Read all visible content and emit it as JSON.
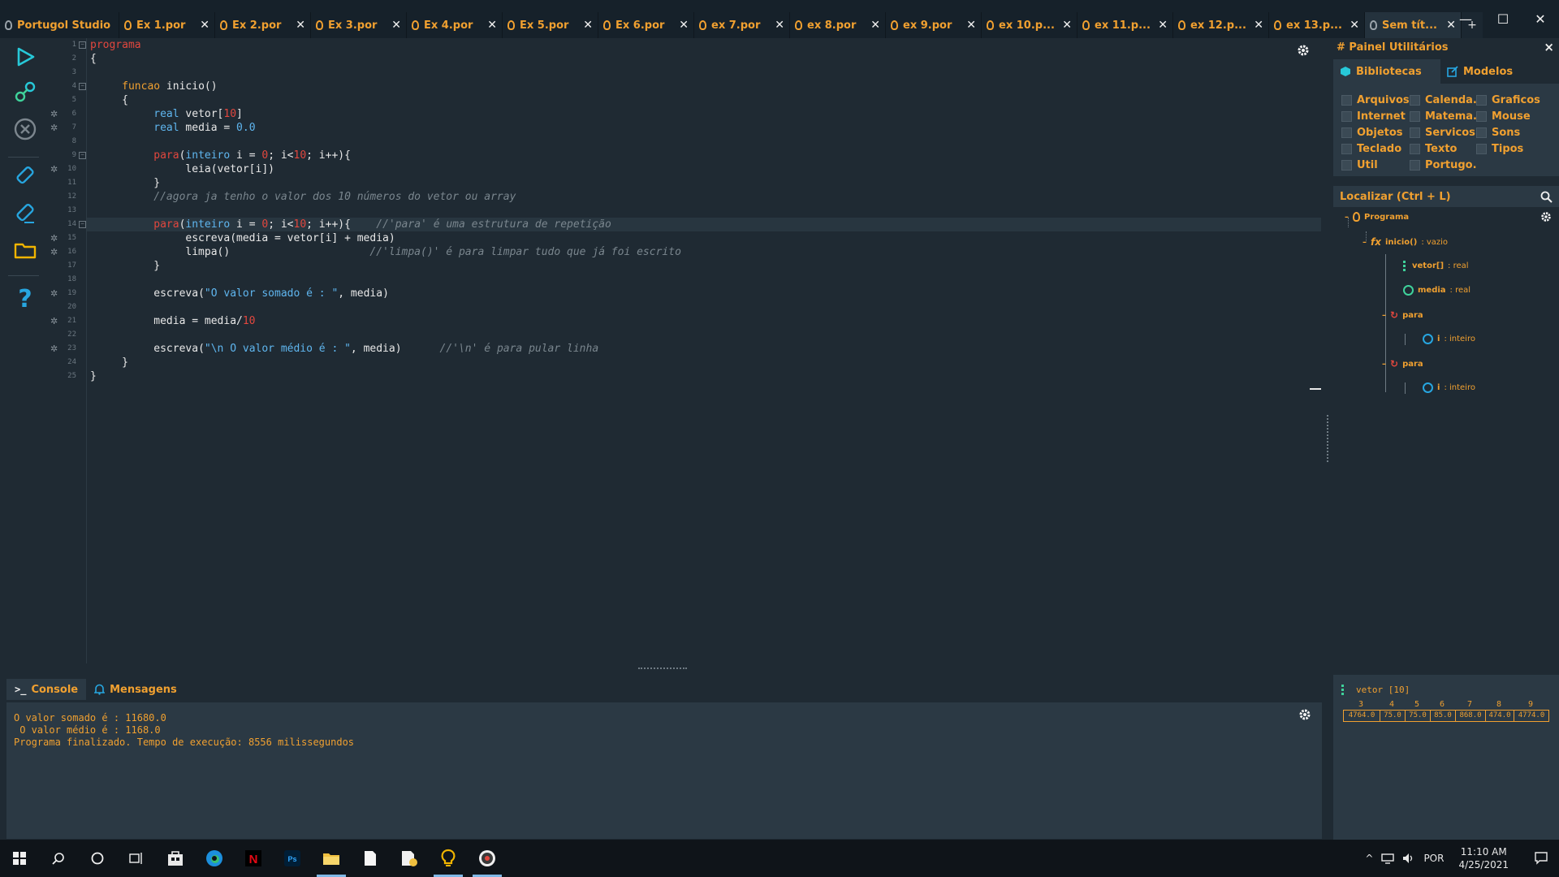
{
  "tabs": [
    {
      "label": "Portugol Studio",
      "closable": false
    },
    {
      "label": "Ex 1.por",
      "closable": true
    },
    {
      "label": "Ex 2.por",
      "closable": true
    },
    {
      "label": "Ex 3.por",
      "closable": true
    },
    {
      "label": "Ex 4.por",
      "closable": true
    },
    {
      "label": "Ex 5.por",
      "closable": true
    },
    {
      "label": "Ex 6.por",
      "closable": true
    },
    {
      "label": "ex 7.por",
      "closable": true
    },
    {
      "label": "ex 8.por",
      "closable": true
    },
    {
      "label": "ex 9.por",
      "closable": true
    },
    {
      "label": "ex 10.p...",
      "closable": true
    },
    {
      "label": "ex 11.p...",
      "closable": true
    },
    {
      "label": "ex 12.p...",
      "closable": true
    },
    {
      "label": "ex 13.p...",
      "closable": true
    },
    {
      "label": "Sem tít...",
      "closable": true,
      "active": true
    }
  ],
  "new_tab": "+",
  "window_controls": {
    "minimize": "—",
    "maximize": "☐",
    "close": "✕"
  },
  "toolbar": {
    "run": "run-icon",
    "debug": "debug-icon",
    "stop": "stop-icon",
    "save": "save-icon",
    "save_as": "save-as-icon",
    "open": "folder-icon",
    "help": "?"
  },
  "code_lines": [
    {
      "n": "1",
      "fold": true,
      "bug": false,
      "html": "<span class='kw'>programa</span>"
    },
    {
      "n": "2",
      "fold": false,
      "bug": false,
      "html": "<span class='plain'>{</span>"
    },
    {
      "n": "3",
      "fold": false,
      "bug": false,
      "html": ""
    },
    {
      "n": "4",
      "fold": true,
      "bug": false,
      "html": "     <span class='fn-kw'>funcao</span><span class='plain'> inicio()</span>"
    },
    {
      "n": "5",
      "fold": false,
      "bug": false,
      "html": "     <span class='plain'>{</span>"
    },
    {
      "n": "6",
      "fold": false,
      "bug": true,
      "html": "          <span class='type'>real</span><span class='plain'> vetor[</span><span class='num'>10</span><span class='plain'>]</span>"
    },
    {
      "n": "7",
      "fold": false,
      "bug": true,
      "html": "          <span class='type'>real</span><span class='plain'> media = </span><span class='type'>0.0</span>"
    },
    {
      "n": "8",
      "fold": false,
      "bug": false,
      "html": ""
    },
    {
      "n": "9",
      "fold": true,
      "bug": false,
      "html": "          <span class='kw'>para</span><span class='plain'>(</span><span class='type'>inteiro</span><span class='plain'> i = </span><span class='num'>0</span><span class='plain'>; i&lt;</span><span class='num'>10</span><span class='plain'>; i++){</span>"
    },
    {
      "n": "10",
      "fold": false,
      "bug": true,
      "html": "               <span class='plain'>leia(vetor[i])</span>"
    },
    {
      "n": "11",
      "fold": false,
      "bug": false,
      "html": "          <span class='plain'>}</span>"
    },
    {
      "n": "12",
      "fold": false,
      "bug": false,
      "html": "          <span class='cmt'>//agora ja tenho o valor dos 10 números do vetor ou array</span>"
    },
    {
      "n": "13",
      "fold": false,
      "bug": false,
      "html": ""
    },
    {
      "n": "14",
      "fold": true,
      "bug": false,
      "current": true,
      "html": "          <span class='kw'>para</span><span class='plain'>(</span><span class='type'>inteiro</span><span class='plain'> i = </span><span class='num'>0</span><span class='plain'>; i&lt;</span><span class='num'>10</span><span class='plain'>; i++){    </span><span class='cmt'>//'para' é uma estrutura de repetição</span>"
    },
    {
      "n": "15",
      "fold": false,
      "bug": true,
      "html": "               <span class='plain'>escreva(media = vetor[i] + media)</span>"
    },
    {
      "n": "16",
      "fold": false,
      "bug": true,
      "html": "               <span class='plain'>limpa()                      </span><span class='cmt'>//'limpa()' é para limpar tudo que já foi escrito</span>"
    },
    {
      "n": "17",
      "fold": false,
      "bug": false,
      "html": "          <span class='plain'>}</span>"
    },
    {
      "n": "18",
      "fold": false,
      "bug": false,
      "html": ""
    },
    {
      "n": "19",
      "fold": false,
      "bug": true,
      "html": "          <span class='plain'>escreva(</span><span class='str'>\"O valor somado é : \"</span><span class='plain'>, media)</span>"
    },
    {
      "n": "20",
      "fold": false,
      "bug": false,
      "html": ""
    },
    {
      "n": "21",
      "fold": false,
      "bug": true,
      "html": "          <span class='plain'>media = media/</span><span class='num'>10</span>"
    },
    {
      "n": "22",
      "fold": false,
      "bug": false,
      "html": ""
    },
    {
      "n": "23",
      "fold": false,
      "bug": true,
      "html": "          <span class='plain'>escreva(</span><span class='str'>\"\\n O valor médio é : \"</span><span class='plain'>, media)      </span><span class='cmt'>//'\\n' é para pular linha</span>"
    },
    {
      "n": "24",
      "fold": false,
      "bug": false,
      "html": "     <span class='plain'>}</span>"
    },
    {
      "n": "25",
      "fold": false,
      "bug": false,
      "html": "<span class='plain'>}</span>"
    }
  ],
  "right_panel": {
    "title": "# Painel Utilitários",
    "close": "×",
    "tab_libs": "Bibliotecas",
    "tab_models": "Modelos",
    "libraries": [
      "Arquivos",
      "Calenda...",
      "Graficos",
      "Internet",
      "Matema...",
      "Mouse",
      "Objetos",
      "Servicos...",
      "Sons",
      "Teclado",
      "Texto",
      "Tipos",
      "Util",
      "Portugo..."
    ],
    "search_label": "Localizar (Ctrl + L)",
    "tree": {
      "root": "Programa",
      "func": "inicio()",
      "func_type": ": vazio",
      "vetor": "vetor[]",
      "vetor_type": ": real",
      "media": "media",
      "media_type": ": real",
      "para1": "para",
      "i1": "i",
      "i1_type": ": inteiro",
      "para2": "para",
      "i2": "i",
      "i2_type": ": inteiro"
    }
  },
  "console": {
    "tab_console": "Console",
    "tab_messages": "Mensagens",
    "lines": [
      "O valor somado é : 11680.0",
      " O valor médio é : 1168.0",
      "Programa finalizado. Tempo de execução: 8556 milissegundos"
    ]
  },
  "inspector": {
    "var_label": "vetor  [10]",
    "indices": [
      "3",
      "4",
      "5",
      "6",
      "7",
      "8",
      "9"
    ],
    "values": [
      "4764.0",
      "75.0",
      "75.0",
      "85.0",
      "868.0",
      "474.0",
      "4774.0"
    ]
  },
  "taskbar": {
    "tray_lang": "POR",
    "time": "11:10 AM",
    "date": "4/25/2021"
  },
  "colors": {
    "accent": "#f0a030",
    "background": "#1f2a33",
    "panel": "#2b3944",
    "keyword": "#e2473e",
    "type": "#5fb6ef"
  }
}
